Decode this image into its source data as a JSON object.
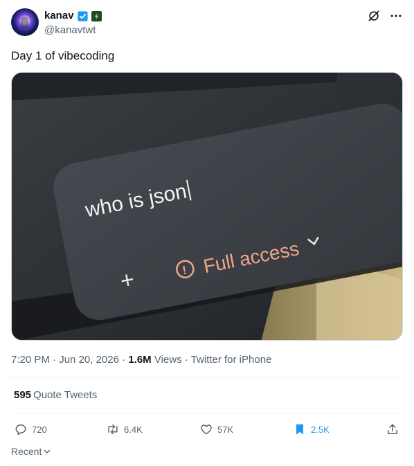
{
  "user": {
    "display_name": "kanav",
    "handle": "@kanavtwt",
    "verified_icon": "verified-badge-icon",
    "affiliate_icon": "affiliate-badge-icon"
  },
  "header_actions": {
    "grok_icon": "grok-icon",
    "more_icon": "more-icon"
  },
  "tweet": {
    "text": "Day 1 of vibecoding",
    "media": {
      "input_text": "who is json",
      "access_label": "Full access",
      "plus_glyph": "+",
      "warning_glyph": "!"
    }
  },
  "meta": {
    "time": "7:20 PM",
    "sep1": " · ",
    "date": "Jun 20, 2026",
    "sep2": " · ",
    "views_count": "1.6M",
    "views_label": " Views",
    "sep3": " · ",
    "source": "Twitter for iPhone"
  },
  "quotes": {
    "count": "595",
    "label": "Quote Tweets"
  },
  "actions": {
    "replies": "720",
    "retweets": "6.4K",
    "likes": "57K",
    "bookmarks": "2.5K"
  },
  "sort": {
    "label": "Recent"
  },
  "colors": {
    "accent": "#1d9bf0",
    "text": "#0f1419",
    "muted": "#536471"
  }
}
